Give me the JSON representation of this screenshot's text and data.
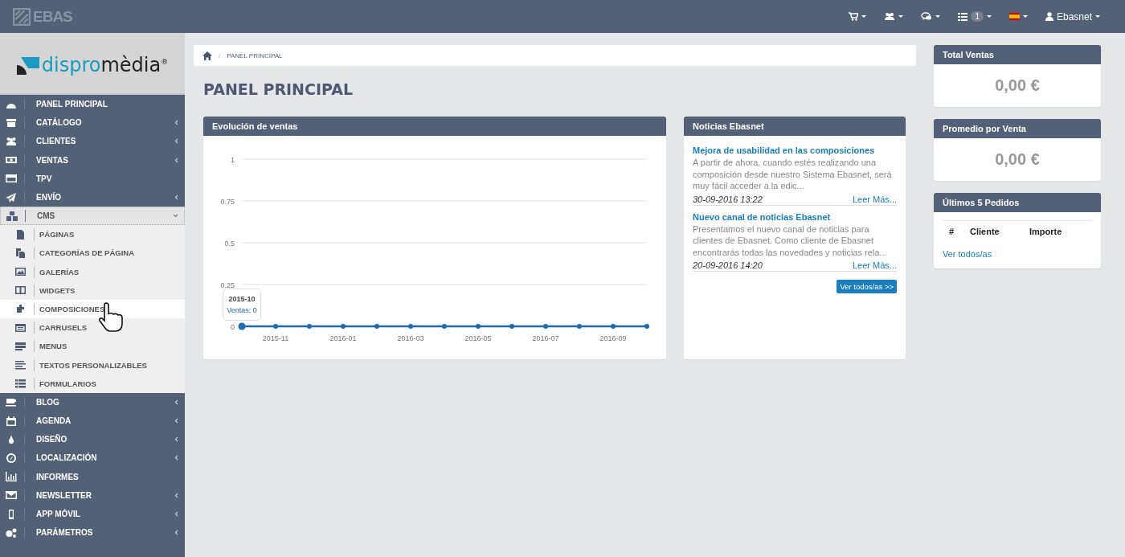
{
  "header": {
    "logo": "EBAS",
    "badge_count": "1",
    "user_name": "Ebasnet"
  },
  "brand": {
    "part_1": "dispro",
    "part_2": "mèdia",
    "mark": "®"
  },
  "sidebar": {
    "items": [
      {
        "label": "PANEL PRINCIPAL",
        "expandable": false,
        "expanded": false,
        "selected": false
      },
      {
        "label": "CATÁLOGO",
        "expandable": true,
        "expanded": false,
        "selected": false
      },
      {
        "label": "CLIENTES",
        "expandable": true,
        "expanded": false,
        "selected": false
      },
      {
        "label": "VENTAS",
        "expandable": true,
        "expanded": false,
        "selected": false
      },
      {
        "label": "TPV",
        "expandable": false,
        "expanded": false,
        "selected": false
      },
      {
        "label": "ENVÍO",
        "expandable": true,
        "expanded": false,
        "selected": false
      },
      {
        "label": "CMS",
        "expandable": true,
        "expanded": true,
        "selected": false,
        "children": [
          {
            "label": "PÁGINAS",
            "selected": false
          },
          {
            "label": "CATEGORÍAS DE PÁGINA",
            "selected": false
          },
          {
            "label": "GALERÍAS",
            "selected": false
          },
          {
            "label": "WIDGETS",
            "selected": false
          },
          {
            "label": "COMPOSICIONES",
            "selected": true
          },
          {
            "label": "CARRUSELS",
            "selected": false
          },
          {
            "label": "MENUS",
            "selected": false
          },
          {
            "label": "TEXTOS PERSONALIZABLES",
            "selected": false
          },
          {
            "label": "FORMULARIOS",
            "selected": false
          }
        ]
      },
      {
        "label": "BLOG",
        "expandable": true,
        "expanded": false,
        "selected": false
      },
      {
        "label": "AGENDA",
        "expandable": true,
        "expanded": false,
        "selected": false
      },
      {
        "label": "DISEÑO",
        "expandable": true,
        "expanded": false,
        "selected": false
      },
      {
        "label": "LOCALIZACIÓN",
        "expandable": true,
        "expanded": false,
        "selected": false
      },
      {
        "label": "INFORMES",
        "expandable": false,
        "expanded": false,
        "selected": false
      },
      {
        "label": "NEWSLETTER",
        "expandable": true,
        "expanded": false,
        "selected": false
      },
      {
        "label": "APP MÓVIL",
        "expandable": true,
        "expanded": false,
        "selected": false
      },
      {
        "label": "PARÁMETROS",
        "expandable": true,
        "expanded": false,
        "selected": false
      }
    ]
  },
  "breadcrumb": {
    "separator": "/",
    "current": "PANEL PRINCIPAL"
  },
  "page_title": "PANEL PRINCIPAL",
  "sales_panel": {
    "title": "Evolución de ventas",
    "tooltip": {
      "title": "2015-10",
      "text": "Ventas: 0"
    },
    "chart_data": {
      "type": "line",
      "grid": true,
      "categories": [
        null,
        "2015-11",
        null,
        "2016-01",
        null,
        "2016-03",
        null,
        "2016-05",
        null,
        "2016-07",
        null,
        "2016-09",
        null
      ],
      "series": [
        {
          "color": "#1f6bb0",
          "marker": "circle",
          "values": [
            0,
            0,
            0,
            0,
            0,
            0,
            0,
            0,
            0,
            0,
            0,
            0,
            0
          ]
        }
      ],
      "ylim": [
        0,
        1
      ],
      "yticks": [
        0,
        0.25,
        0.5,
        0.75,
        1
      ]
    }
  },
  "news_panel": {
    "title": "Noticias Ebasnet",
    "items": [
      {
        "title": "Mejora de usabilidad en las composiciones",
        "text": "A partir de ahora, cuando estés realizando una composición desde nuestro Sistema Ebasnet, será muy fácil acceder a la edic...",
        "date": "30-09-2016 13:22",
        "link": "Leer Más..."
      },
      {
        "title": "Nuevo canal de noticias Ebasnet",
        "text": "Presentamos el nuevo canal de noticias para clientes de Ebasnet. Como cliente de Ebasnet encontrarás todas las novedades y noticias rela...",
        "date": "20-09-2016 14:20",
        "link": "Leer Más..."
      }
    ],
    "button": "Ver todos/as >>"
  },
  "stats": [
    {
      "title": "Total Ventas",
      "value": "0,00 €"
    },
    {
      "title": "Promedio por Venta",
      "value": "0,00 €"
    }
  ],
  "orders_panel": {
    "title": "Últimos 5 Pedidos",
    "columns": [
      "#",
      "Cliente",
      "Importe"
    ],
    "link": "Ver todos/as"
  }
}
